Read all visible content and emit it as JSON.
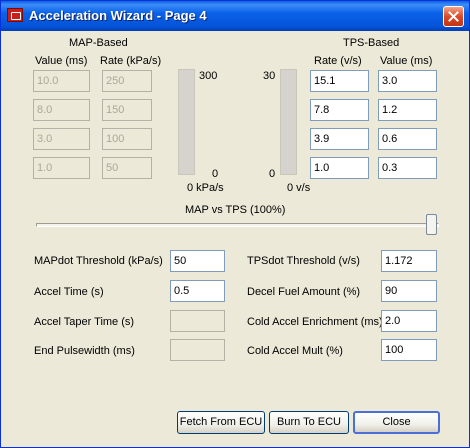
{
  "window": {
    "title": "Acceleration Wizard - Page 4"
  },
  "map": {
    "heading": "MAP-Based",
    "col_value": "Value (ms)",
    "col_rate": "Rate (kPa/s)",
    "values": [
      "10.0",
      "8.0",
      "3.0",
      "1.0"
    ],
    "rates": [
      "250",
      "150",
      "100",
      "50"
    ],
    "gauge_max": "300",
    "gauge_min": "0",
    "gauge_unit": "0 kPa/s"
  },
  "tps": {
    "heading": "TPS-Based",
    "col_rate": "Rate (v/s)",
    "col_value": "Value (ms)",
    "rates": [
      "15.1",
      "7.8",
      "3.9",
      "1.0"
    ],
    "values": [
      "3.0",
      "1.2",
      "0.6",
      "0.3"
    ],
    "gauge_max": "30",
    "gauge_min": "0",
    "gauge_unit": "0 v/s"
  },
  "slider": {
    "label": "MAP vs TPS (100%)",
    "value_percent": 100
  },
  "params": {
    "mapdot_label": "MAPdot Threshold (kPa/s)",
    "mapdot_value": "50",
    "accel_time_label": "Accel Time (s)",
    "accel_time_value": "0.5",
    "accel_taper_label": "Accel Taper Time (s)",
    "accel_taper_value": "",
    "end_pw_label": "End Pulsewidth (ms)",
    "end_pw_value": "",
    "tpsdot_label": "TPSdot Threshold (v/s)",
    "tpsdot_value": "1.172",
    "decel_label": "Decel Fuel Amount (%)",
    "decel_value": "90",
    "cold_enrich_label": "Cold Accel Enrichment (ms)",
    "cold_enrich_value": "2.0",
    "cold_mult_label": "Cold Accel Mult (%)",
    "cold_mult_value": "100"
  },
  "buttons": {
    "fetch": "Fetch From ECU",
    "burn": "Burn To ECU",
    "close": "Close"
  }
}
